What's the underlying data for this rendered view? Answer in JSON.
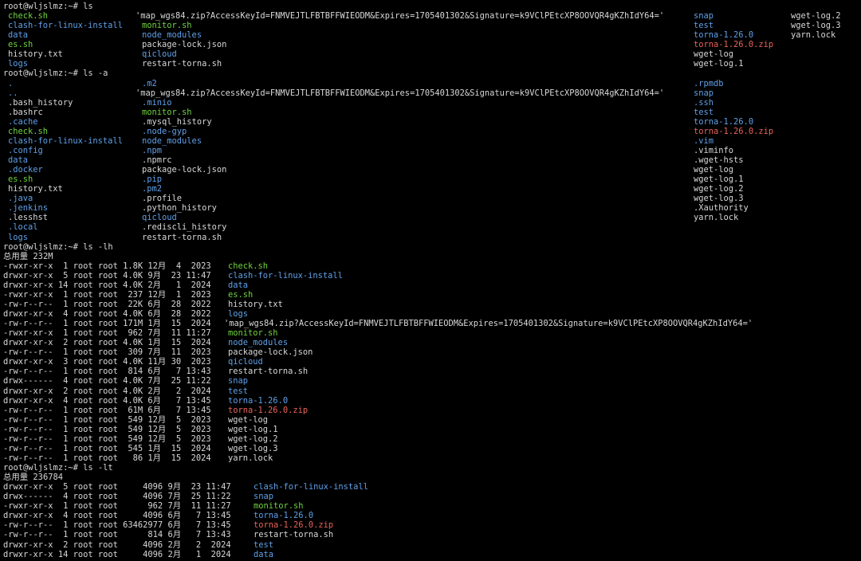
{
  "colors": {
    "background": "#000000",
    "white": "#d8d8d8",
    "green": "#6fd33f",
    "blue": "#5fa0e8",
    "red": "#e8635a",
    "yellow": "#d6c950"
  },
  "terminal": {
    "lines": [
      {
        "kind": "prompt",
        "cells": [
          {
            "t": "root@wljslmz:~# ls",
            "c": "white"
          }
        ]
      },
      {
        "kind": "output",
        "cells": [
          {
            "t": "check.sh",
            "c": "green",
            "col": 1
          },
          {
            "t": "'map_wgs84.zip?AccessKeyId=FNMVEJTLFBTBFFWIEODM&Expires=1705401302&Signature=k9VClPEtcXP8OOVQR4gKZhIdY64='",
            "c": "white",
            "col": 2
          },
          {
            "t": "snap",
            "c": "blue",
            "col": 4
          },
          {
            "t": "wget-log.2",
            "c": "white",
            "col": 5
          }
        ]
      },
      {
        "kind": "output",
        "cells": [
          {
            "t": "clash-for-linux-install",
            "c": "blue",
            "col": 1
          },
          {
            "t": "monitor.sh",
            "c": "green",
            "col": 3
          },
          {
            "t": "test",
            "c": "blue",
            "col": 4
          },
          {
            "t": "wget-log.3",
            "c": "white",
            "col": 5
          }
        ]
      },
      {
        "kind": "output",
        "cells": [
          {
            "t": "data",
            "c": "blue",
            "col": 1
          },
          {
            "t": "node_modules",
            "c": "blue",
            "col": 3
          },
          {
            "t": "torna-1.26.0",
            "c": "blue",
            "col": 4
          },
          {
            "t": "yarn.lock",
            "c": "white",
            "col": 5
          }
        ]
      },
      {
        "kind": "output",
        "cells": [
          {
            "t": "es.sh",
            "c": "green",
            "col": 1
          },
          {
            "t": "package-lock.json",
            "c": "white",
            "col": 3
          },
          {
            "t": "torna-1.26.0.zip",
            "c": "red",
            "col": 4
          }
        ]
      },
      {
        "kind": "output",
        "cells": [
          {
            "t": "history.txt",
            "c": "white",
            "col": 1
          },
          {
            "t": "qicloud",
            "c": "blue",
            "col": 3
          },
          {
            "t": "wget-log",
            "c": "white",
            "col": 4
          }
        ]
      },
      {
        "kind": "output",
        "cells": [
          {
            "t": "logs",
            "c": "blue",
            "col": 1
          },
          {
            "t": "restart-torna.sh",
            "c": "white",
            "col": 3
          },
          {
            "t": "wget-log.1",
            "c": "white",
            "col": 4
          }
        ]
      },
      {
        "kind": "prompt",
        "cells": [
          {
            "t": "root@wljslmz:~# ls -a",
            "c": "white"
          }
        ]
      },
      {
        "kind": "output",
        "cells": [
          {
            "t": ".",
            "c": "blue",
            "col": 1
          },
          {
            "t": ".m2",
            "c": "blue",
            "col": 3
          },
          {
            "t": ".rpmdb",
            "c": "blue",
            "col": 4
          }
        ]
      },
      {
        "kind": "output",
        "cells": [
          {
            "t": "..",
            "c": "blue",
            "col": 1
          },
          {
            "t": "'map_wgs84.zip?AccessKeyId=FNMVEJTLFBTBFFWIEODM&Expires=1705401302&Signature=k9VClPEtcXP8OOVQR4gKZhIdY64='",
            "c": "white",
            "col": 2
          },
          {
            "t": "snap",
            "c": "blue",
            "col": 4
          }
        ]
      },
      {
        "kind": "output",
        "cells": [
          {
            "t": ".bash_history",
            "c": "white",
            "col": 1
          },
          {
            "t": ".minio",
            "c": "blue",
            "col": 3
          },
          {
            "t": ".ssh",
            "c": "blue",
            "col": 4
          }
        ]
      },
      {
        "kind": "output",
        "cells": [
          {
            "t": ".bashrc",
            "c": "white",
            "col": 1
          },
          {
            "t": "monitor.sh",
            "c": "green",
            "col": 3
          },
          {
            "t": "test",
            "c": "blue",
            "col": 4
          }
        ]
      },
      {
        "kind": "output",
        "cells": [
          {
            "t": ".cache",
            "c": "blue",
            "col": 1
          },
          {
            "t": ".mysql_history",
            "c": "white",
            "col": 3
          },
          {
            "t": "torna-1.26.0",
            "c": "blue",
            "col": 4
          }
        ]
      },
      {
        "kind": "output",
        "cells": [
          {
            "t": "check.sh",
            "c": "green",
            "col": 1
          },
          {
            "t": ".node-gyp",
            "c": "blue",
            "col": 3
          },
          {
            "t": "torna-1.26.0.zip",
            "c": "red",
            "col": 4
          }
        ]
      },
      {
        "kind": "output",
        "cells": [
          {
            "t": "clash-for-linux-install",
            "c": "blue",
            "col": 1
          },
          {
            "t": "node_modules",
            "c": "blue",
            "col": 3
          },
          {
            "t": ".vim",
            "c": "blue",
            "col": 4
          }
        ]
      },
      {
        "kind": "output",
        "cells": [
          {
            "t": ".config",
            "c": "blue",
            "col": 1
          },
          {
            "t": ".npm",
            "c": "blue",
            "col": 3
          },
          {
            "t": ".viminfo",
            "c": "white",
            "col": 4
          }
        ]
      },
      {
        "kind": "output",
        "cells": [
          {
            "t": "data",
            "c": "blue",
            "col": 1
          },
          {
            "t": ".npmrc",
            "c": "white",
            "col": 3
          },
          {
            "t": ".wget-hsts",
            "c": "white",
            "col": 4
          }
        ]
      },
      {
        "kind": "output",
        "cells": [
          {
            "t": ".docker",
            "c": "blue",
            "col": 1
          },
          {
            "t": "package-lock.json",
            "c": "white",
            "col": 3
          },
          {
            "t": "wget-log",
            "c": "white",
            "col": 4
          }
        ]
      },
      {
        "kind": "output",
        "cells": [
          {
            "t": "es.sh",
            "c": "green",
            "col": 1
          },
          {
            "t": ".pip",
            "c": "blue",
            "col": 3
          },
          {
            "t": "wget-log.1",
            "c": "white",
            "col": 4
          }
        ]
      },
      {
        "kind": "output",
        "cells": [
          {
            "t": "history.txt",
            "c": "white",
            "col": 1
          },
          {
            "t": ".pm2",
            "c": "blue",
            "col": 3
          },
          {
            "t": "wget-log.2",
            "c": "white",
            "col": 4
          }
        ]
      },
      {
        "kind": "output",
        "cells": [
          {
            "t": ".java",
            "c": "blue",
            "col": 1
          },
          {
            "t": ".profile",
            "c": "white",
            "col": 3
          },
          {
            "t": "wget-log.3",
            "c": "white",
            "col": 4
          }
        ]
      },
      {
        "kind": "output",
        "cells": [
          {
            "t": ".jenkins",
            "c": "blue",
            "col": 1
          },
          {
            "t": ".python_history",
            "c": "white",
            "col": 3
          },
          {
            "t": ".Xauthority",
            "c": "white",
            "col": 4
          }
        ]
      },
      {
        "kind": "output",
        "cells": [
          {
            "t": ".lesshst",
            "c": "white",
            "col": 1
          },
          {
            "t": "qicloud",
            "c": "blue",
            "col": 3
          },
          {
            "t": "yarn.lock",
            "c": "white",
            "col": 4
          }
        ]
      },
      {
        "kind": "output",
        "cells": [
          {
            "t": ".local",
            "c": "blue",
            "col": 1
          },
          {
            "t": ".rediscli_history",
            "c": "white",
            "col": 3
          }
        ]
      },
      {
        "kind": "output",
        "cells": [
          {
            "t": "logs",
            "c": "blue",
            "col": 1
          },
          {
            "t": "restart-torna.sh",
            "c": "white",
            "col": 3
          }
        ]
      },
      {
        "kind": "prompt",
        "cells": [
          {
            "t": "root@wljslmz:~# ls -lh",
            "c": "white"
          }
        ]
      },
      {
        "kind": "output",
        "cells": [
          {
            "t": "总用量 232M",
            "c": "white"
          }
        ]
      },
      {
        "kind": "long",
        "cells": [
          {
            "t": "-rwxr-xr-x  1 root root 1.8K 12月  4  2023",
            "c": "white",
            "col": 0
          },
          {
            "t": "check.sh",
            "c": "green",
            "col": 6
          }
        ]
      },
      {
        "kind": "long",
        "cells": [
          {
            "t": "drwxr-xr-x  5 root root 4.0K 9月  23 11:47",
            "c": "white",
            "col": 0
          },
          {
            "t": "clash-for-linux-install",
            "c": "blue",
            "col": 6
          }
        ]
      },
      {
        "kind": "long",
        "cells": [
          {
            "t": "drwxr-xr-x 14 root root 4.0K 2月   1  2024",
            "c": "white",
            "col": 0
          },
          {
            "t": "data",
            "c": "blue",
            "col": 6
          }
        ]
      },
      {
        "kind": "long",
        "cells": [
          {
            "t": "-rwxr-xr-x  1 root root  237 12月  1  2023",
            "c": "white",
            "col": 0
          },
          {
            "t": "es.sh",
            "c": "green",
            "col": 6
          }
        ]
      },
      {
        "kind": "long",
        "cells": [
          {
            "t": "-rw-r--r--  1 root root  22K 6月  28  2022",
            "c": "white",
            "col": 0
          },
          {
            "t": "history.txt",
            "c": "white",
            "col": 6
          }
        ]
      },
      {
        "kind": "long",
        "cells": [
          {
            "t": "drwxr-xr-x  4 root root 4.0K 6月  28  2022",
            "c": "white",
            "col": 0
          },
          {
            "t": "logs",
            "c": "blue",
            "col": 6
          }
        ]
      },
      {
        "kind": "long",
        "cells": [
          {
            "t": "-rw-r--r--  1 root root 171M 1月  15  2024",
            "c": "white",
            "col": 0
          },
          {
            "t": "'map_wgs84.zip?AccessKeyId=FNMVEJTLFBTBFFWIEODM&Expires=1705401302&Signature=k9VClPEtcXP8OOVQR4gKZhIdY64='",
            "c": "white",
            "col": 7
          }
        ]
      },
      {
        "kind": "long",
        "cells": [
          {
            "t": "-rwxr-xr-x  1 root root  962 7月  11 11:27",
            "c": "white",
            "col": 0
          },
          {
            "t": "monitor.sh",
            "c": "green",
            "col": 6
          }
        ]
      },
      {
        "kind": "long",
        "cells": [
          {
            "t": "drwxr-xr-x  2 root root 4.0K 1月  15  2024",
            "c": "white",
            "col": 0
          },
          {
            "t": "node_modules",
            "c": "blue",
            "col": 6
          }
        ]
      },
      {
        "kind": "long",
        "cells": [
          {
            "t": "-rw-r--r--  1 root root  309 7月  11  2023",
            "c": "white",
            "col": 0
          },
          {
            "t": "package-lock.json",
            "c": "white",
            "col": 6
          }
        ]
      },
      {
        "kind": "long",
        "cells": [
          {
            "t": "drwxr-xr-x  3 root root 4.0K 11月 30  2023",
            "c": "white",
            "col": 0
          },
          {
            "t": "qicloud",
            "c": "blue",
            "col": 6
          }
        ]
      },
      {
        "kind": "long",
        "cells": [
          {
            "t": "-rw-r--r--  1 root root  814 6月   7 13:43",
            "c": "white",
            "col": 0
          },
          {
            "t": "restart-torna.sh",
            "c": "white",
            "col": 6
          }
        ]
      },
      {
        "kind": "long",
        "cells": [
          {
            "t": "drwx------  4 root root 4.0K 7月  25 11:22",
            "c": "white",
            "col": 0
          },
          {
            "t": "snap",
            "c": "blue",
            "col": 6
          }
        ]
      },
      {
        "kind": "long",
        "cells": [
          {
            "t": "drwxr-xr-x  2 root root 4.0K 2月   2  2024",
            "c": "white",
            "col": 0
          },
          {
            "t": "test",
            "c": "blue",
            "col": 6
          }
        ]
      },
      {
        "kind": "long",
        "cells": [
          {
            "t": "drwxr-xr-x  4 root root 4.0K 6月   7 13:45",
            "c": "white",
            "col": 0
          },
          {
            "t": "torna-1.26.0",
            "c": "blue",
            "col": 6
          }
        ]
      },
      {
        "kind": "long",
        "cells": [
          {
            "t": "-rw-r--r--  1 root root  61M 6月   7 13:45",
            "c": "white",
            "col": 0
          },
          {
            "t": "torna-1.26.0.zip",
            "c": "red",
            "col": 6
          }
        ]
      },
      {
        "kind": "long",
        "cells": [
          {
            "t": "-rw-r--r--  1 root root  549 12月  5  2023",
            "c": "white",
            "col": 0
          },
          {
            "t": "wget-log",
            "c": "white",
            "col": 6
          }
        ]
      },
      {
        "kind": "long",
        "cells": [
          {
            "t": "-rw-r--r--  1 root root  549 12月  5  2023",
            "c": "white",
            "col": 0
          },
          {
            "t": "wget-log.1",
            "c": "white",
            "col": 6
          }
        ]
      },
      {
        "kind": "long",
        "cells": [
          {
            "t": "-rw-r--r--  1 root root  549 12月  5  2023",
            "c": "white",
            "col": 0
          },
          {
            "t": "wget-log.2",
            "c": "white",
            "col": 6
          }
        ]
      },
      {
        "kind": "long",
        "cells": [
          {
            "t": "-rw-r--r--  1 root root  545 1月  15  2024",
            "c": "white",
            "col": 0
          },
          {
            "t": "wget-log.3",
            "c": "white",
            "col": 6
          }
        ]
      },
      {
        "kind": "long",
        "cells": [
          {
            "t": "-rw-r--r--  1 root root   86 1月  15  2024",
            "c": "white",
            "col": 0
          },
          {
            "t": "yarn.lock",
            "c": "white",
            "col": 6
          }
        ]
      },
      {
        "kind": "prompt",
        "cells": [
          {
            "t": "root@wljslmz:~# ls -lt",
            "c": "white"
          }
        ]
      },
      {
        "kind": "output",
        "cells": [
          {
            "t": "总用量 236784",
            "c": "white"
          }
        ]
      },
      {
        "kind": "long",
        "cells": [
          {
            "t": "drwxr-xr-x  5 root root     4096 9月  23 11:47",
            "c": "white",
            "col": 0
          },
          {
            "t": "clash-for-linux-install",
            "c": "blue",
            "col": 8
          }
        ]
      },
      {
        "kind": "long",
        "cells": [
          {
            "t": "drwx------  4 root root     4096 7月  25 11:22",
            "c": "white",
            "col": 0
          },
          {
            "t": "snap",
            "c": "blue",
            "col": 8
          }
        ]
      },
      {
        "kind": "long",
        "cells": [
          {
            "t": "-rwxr-xr-x  1 root root      962 7月  11 11:27",
            "c": "white",
            "col": 0
          },
          {
            "t": "monitor.sh",
            "c": "green",
            "col": 8
          }
        ]
      },
      {
        "kind": "long",
        "cells": [
          {
            "t": "drwxr-xr-x  4 root root     4096 6月   7 13:45",
            "c": "white",
            "col": 0
          },
          {
            "t": "torna-1.26.0",
            "c": "blue",
            "col": 8
          }
        ]
      },
      {
        "kind": "long",
        "cells": [
          {
            "t": "-rw-r--r--  1 root root 63462977 6月   7 13:45",
            "c": "white",
            "col": 0
          },
          {
            "t": "torna-1.26.0.zip",
            "c": "red",
            "col": 8
          }
        ]
      },
      {
        "kind": "long",
        "cells": [
          {
            "t": "-rw-r--r--  1 root root      814 6月   7 13:43",
            "c": "white",
            "col": 0
          },
          {
            "t": "restart-torna.sh",
            "c": "white",
            "col": 8
          }
        ]
      },
      {
        "kind": "long",
        "cells": [
          {
            "t": "drwxr-xr-x  2 root root     4096 2月   2  2024",
            "c": "white",
            "col": 0
          },
          {
            "t": "test",
            "c": "blue",
            "col": 8
          }
        ]
      },
      {
        "kind": "long",
        "cells": [
          {
            "t": "drwxr-xr-x 14 root root     4096 2月   1  2024",
            "c": "white",
            "col": 0
          },
          {
            "t": "data",
            "c": "blue",
            "col": 8
          }
        ]
      }
    ]
  }
}
